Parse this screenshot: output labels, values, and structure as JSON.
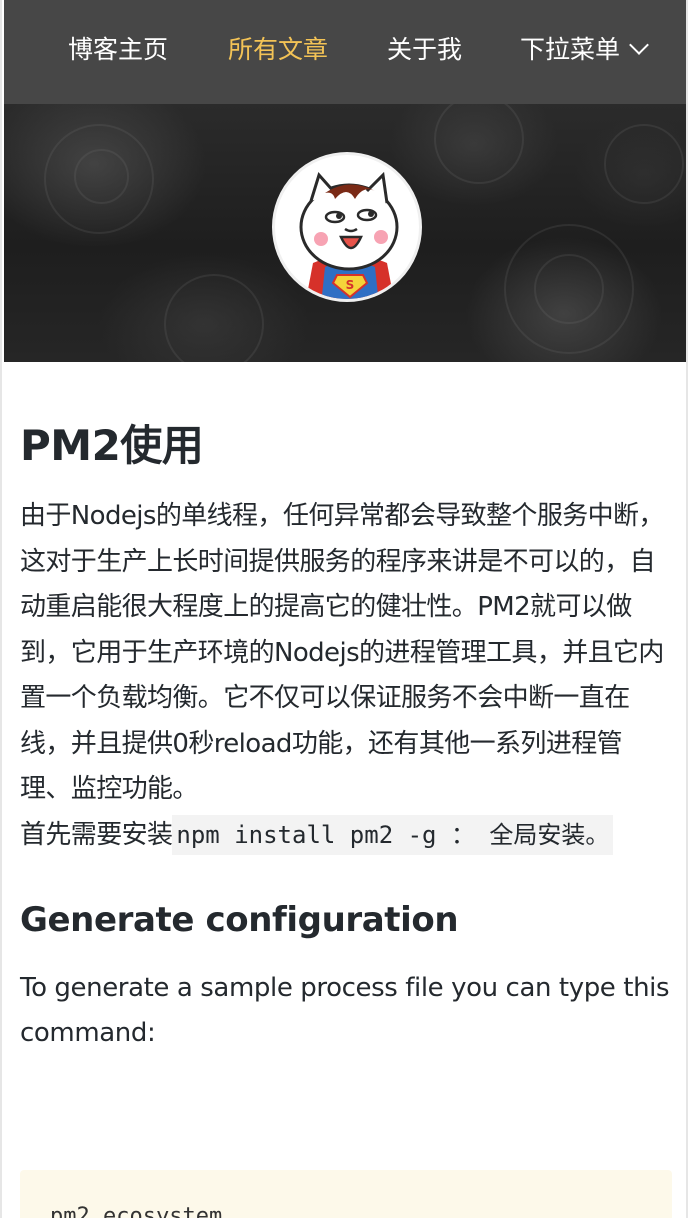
{
  "nav": {
    "items": [
      {
        "label": "博客主页",
        "active": false
      },
      {
        "label": "所有文章",
        "active": true
      },
      {
        "label": "关于我",
        "active": false
      },
      {
        "label": "下拉菜单",
        "active": false,
        "has_dropdown": true
      }
    ],
    "active_color": "#f3c356",
    "background": "#474747"
  },
  "hero": {
    "avatar_icon": "superman-cat-avatar"
  },
  "article": {
    "title": "PM2使用",
    "intro": "由于Nodejs的单线程，任何异常都会导致整个服务中断，这对于生产上长时间提供服务的程序来讲是不可以的，自动重启能很大程度上的提高它的健壮性。PM2就可以做到，它用于生产环境的Nodejs的进程管理工具，并且它内置一个负载均衡。它不仅可以保证服务不会中断一直在线，并且提供0秒reload功能，还有其他一系列进程管理、监控功能。",
    "install_prefix": "首先需要安装",
    "install_code": "npm install pm2 -g ： 全局安装。",
    "section_heading": "Generate configuration",
    "section_text": "To generate a sample process file you can type this command:",
    "code_block": "pm2 ecosystem"
  }
}
